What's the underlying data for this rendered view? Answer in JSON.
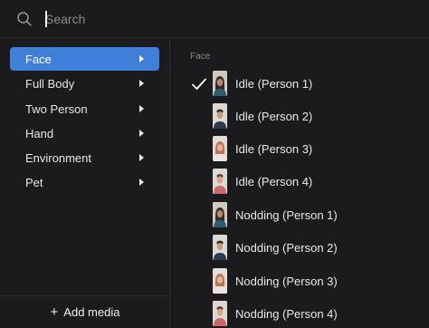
{
  "search": {
    "placeholder": "Search",
    "value": ""
  },
  "sidebar": {
    "items": [
      {
        "label": "Face",
        "active": true
      },
      {
        "label": "Full Body",
        "active": false
      },
      {
        "label": "Two Person",
        "active": false
      },
      {
        "label": "Hand",
        "active": false
      },
      {
        "label": "Environment",
        "active": false
      },
      {
        "label": "Pet",
        "active": false
      }
    ],
    "add_media": {
      "icon": "plus-icon",
      "label": "Add media"
    }
  },
  "list": {
    "section_label": "Face",
    "items": [
      {
        "label": "Idle (Person 1)",
        "selected": true,
        "thumb": "person-1-thumbnail"
      },
      {
        "label": "Idle (Person 2)",
        "selected": false,
        "thumb": "person-2-thumbnail"
      },
      {
        "label": "Idle (Person 3)",
        "selected": false,
        "thumb": "person-3-thumbnail"
      },
      {
        "label": "Idle (Person 4)",
        "selected": false,
        "thumb": "person-4-thumbnail"
      },
      {
        "label": "Nodding (Person 1)",
        "selected": false,
        "thumb": "person-1-thumbnail"
      },
      {
        "label": "Nodding (Person 2)",
        "selected": false,
        "thumb": "person-2-thumbnail"
      },
      {
        "label": "Nodding (Person 3)",
        "selected": false,
        "thumb": "person-3-thumbnail"
      },
      {
        "label": "Nodding (Person 4)",
        "selected": false,
        "thumb": "person-4-thumbnail"
      }
    ]
  },
  "colors": {
    "background": "#1b1b1d",
    "accent": "#3f7fd9",
    "divider": "#2e2e31",
    "text": "#e8e8ea",
    "muted": "#8a8a8e"
  }
}
